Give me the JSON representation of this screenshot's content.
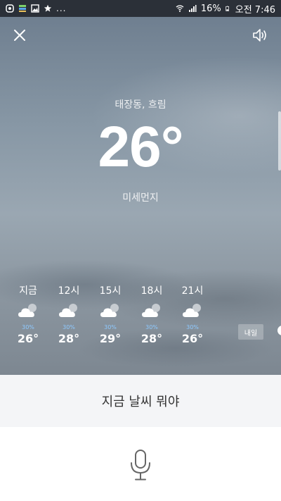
{
  "status_bar": {
    "battery": "16%",
    "time": "오전 7:46",
    "dots": "..."
  },
  "weather": {
    "location_condition": "태장동, 흐림",
    "temperature": "26°",
    "fine_dust_label": "미세먼지",
    "forecast": [
      {
        "time": "지금",
        "precip": "30%",
        "temp": "26°",
        "icon": "cloud-icon"
      },
      {
        "time": "12시",
        "precip": "30%",
        "temp": "28°",
        "icon": "cloud-icon"
      },
      {
        "time": "15시",
        "precip": "30%",
        "temp": "29°",
        "icon": "cloud-icon"
      },
      {
        "time": "18시",
        "precip": "30%",
        "temp": "28°",
        "icon": "cloud-icon"
      },
      {
        "time": "21시",
        "precip": "30%",
        "temp": "26°",
        "icon": "cloud-icon"
      }
    ],
    "tomorrow_label": "내일"
  },
  "query": {
    "text": "지금 날씨 뭐야"
  },
  "colors": {
    "precip": "#8ec9ff",
    "query_bg": "#f4f5f7",
    "status_bg": "#2b3038"
  }
}
